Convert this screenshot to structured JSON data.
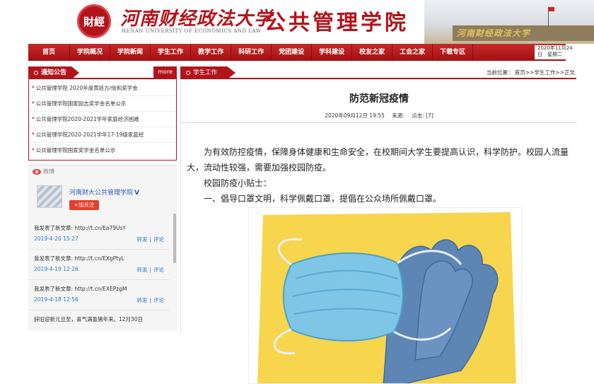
{
  "header": {
    "seal_text": "財經",
    "university_cn": "河南财经政法大学",
    "university_en": "HENAN UNIVERSITY OF ECONOMICS AND LAW",
    "college_name": "公共管理学院",
    "gate_text": "河南财经政法大学"
  },
  "nav": {
    "items": [
      "首页",
      "学院概况",
      "学院新闻",
      "学生工作",
      "教学工作",
      "科研工作",
      "党团建设",
      "学科建设",
      "校友之家",
      "工会之家",
      "下载专区"
    ],
    "date_line1": "2020年11月24",
    "date_line2": "日　星期二"
  },
  "notice_panel": {
    "title": "通知公告",
    "more": "more",
    "items": [
      "公共管理学院 2020年度黄廷方/信和奖学金",
      "公共管理学院国家励志奖学金名单公示",
      "公共管理学院2020-2021学年家庭经济困难",
      "公共管理学院2020-2021学年17-19级家庭经",
      "公共管理学院国家奖学金名单公示"
    ]
  },
  "weibo": {
    "label": "微博",
    "account_name": "河南财大公共管理学院",
    "verified": "V",
    "follow_label": "+加关注",
    "repost_label": "转发",
    "comment_label": "评论",
    "posts": [
      {
        "text": "我发表了新文章: http://t.cn/Ea79UsY",
        "date": "2019-4-20 15:27"
      },
      {
        "text": "我发表了新文章: http://t.cn/EXgPtyL",
        "date": "2019-4-19 12:26"
      },
      {
        "text": "我发表了新文章: http://t.cn/EXEPzgM",
        "date": "2019-4-18 12:56"
      },
      {
        "text": "辞旧迎新元旦至，喜气满盈猪年来。12月30日",
        "date": ""
      }
    ]
  },
  "main": {
    "section_tab": "学生工作",
    "location": "当前位置： 首页>>学生工作>>正文"
  },
  "article": {
    "title": "防范新冠疫情",
    "date": "2020年09月12日 19:55",
    "source_label": "来源:",
    "clicks_label": "点击:",
    "clicks": "[7]",
    "paragraphs": [
      "为有效防控疫情，保障身体健康和生命安全，在校期间大学生要提高认识，科学防护。校园人流量大，流动性较强，需要加强校园防疫。",
      "校园防疫小贴士：",
      "一、倡导口罩文明，科学佩戴口罩，提倡在公众场所佩戴口罩。"
    ]
  },
  "colors": {
    "brand_red": "#b3141b",
    "nav_red": "#a30f12",
    "weibo_red": "#e43f2c",
    "link_blue": "#2a78c8",
    "illustration_yellow": "#f7d54d",
    "mask_blue": "#7ec5e6",
    "glove_blue": "#5d86b5"
  }
}
